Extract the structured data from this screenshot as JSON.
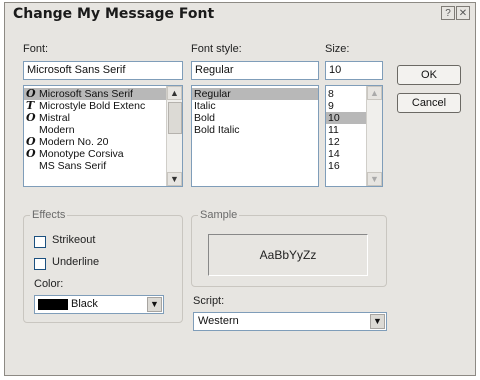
{
  "window": {
    "title": "Change My Message Font",
    "help_label": "?",
    "close_label": "✕"
  },
  "font": {
    "label": "Font:",
    "value": "Microsoft Sans Serif",
    "items": [
      {
        "label": "Microsoft Sans Serif",
        "icon": "opentype-font-icon",
        "glyph": "O",
        "selected": true
      },
      {
        "label": "Microstyle Bold Extenc",
        "icon": "truetype-font-icon",
        "glyph": "T",
        "selected": false
      },
      {
        "label": "Mistral",
        "icon": "opentype-font-icon",
        "glyph": "O",
        "selected": false
      },
      {
        "label": "Modern",
        "icon": "",
        "glyph": "",
        "selected": false
      },
      {
        "label": "Modern No. 20",
        "icon": "opentype-font-icon",
        "glyph": "O",
        "selected": false
      },
      {
        "label": "Monotype Corsiva",
        "icon": "opentype-font-icon",
        "glyph": "O",
        "selected": false
      },
      {
        "label": "MS Sans Serif",
        "icon": "",
        "glyph": "",
        "selected": false
      }
    ]
  },
  "style": {
    "label": "Font style:",
    "value": "Regular",
    "items": [
      "Regular",
      "Italic",
      "Bold",
      "Bold Italic"
    ]
  },
  "size": {
    "label": "Size:",
    "value": "10",
    "items": [
      "8",
      "9",
      "10",
      "11",
      "12",
      "14",
      "16"
    ]
  },
  "buttons": {
    "ok": "OK",
    "cancel": "Cancel"
  },
  "effects": {
    "title": "Effects",
    "strikeout": "Strikeout",
    "underline": "Underline",
    "color_label": "Color:",
    "color_value": "Black",
    "color_swatch": "#000000"
  },
  "sample": {
    "title": "Sample",
    "text": "AaBbYyZz"
  },
  "script": {
    "label": "Script:",
    "value": "Western"
  },
  "scroll": {
    "up": "▲",
    "down": "▼"
  }
}
